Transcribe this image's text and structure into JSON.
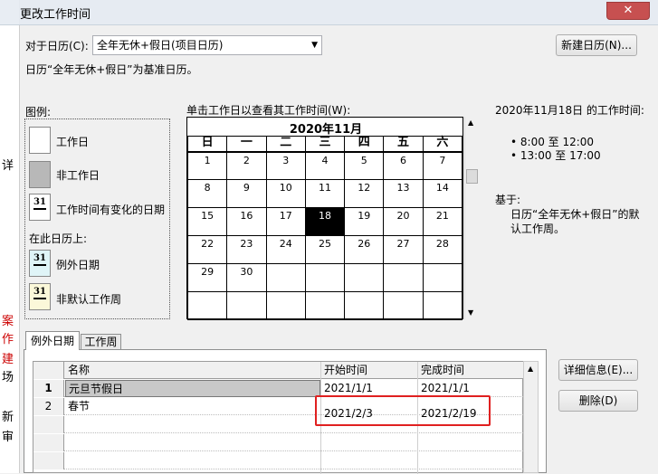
{
  "window": {
    "title": "更改工作时间",
    "close_glyph": "✕"
  },
  "background": {
    "left_chars": [
      "详",
      "案",
      "作",
      "建",
      "场",
      "新",
      "审"
    ]
  },
  "calendar_for": {
    "label": "对于日历(C):",
    "value": "全年无休+假日(项目日历)",
    "base_note": "日历“全年无休+假日”为基准日历。",
    "new_button": "新建日历(N)..."
  },
  "legend": {
    "title": "图例:",
    "items": [
      {
        "label": "工作日",
        "swatch": ""
      },
      {
        "label": "非工作日",
        "swatch": ""
      },
      {
        "label": "工作时间有变化的日期",
        "swatch": "31"
      }
    ],
    "on_this_calendar": "在此日历上:",
    "items2": [
      {
        "label": "例外日期",
        "swatch": "31"
      },
      {
        "label": "非默认工作周",
        "swatch": "31"
      }
    ]
  },
  "calendar": {
    "instruction": "单击工作日以查看其工作时间(W):",
    "month_title": "2020年11月",
    "weekdays": [
      "日",
      "一",
      "二",
      "三",
      "四",
      "五",
      "六"
    ],
    "weeks": [
      [
        "1",
        "2",
        "3",
        "4",
        "5",
        "6",
        "7"
      ],
      [
        "8",
        "9",
        "10",
        "11",
        "12",
        "13",
        "14"
      ],
      [
        "15",
        "16",
        "17",
        "18",
        "19",
        "20",
        "21"
      ],
      [
        "22",
        "23",
        "24",
        "25",
        "26",
        "27",
        "28"
      ],
      [
        "29",
        "30",
        "",
        "",
        "",
        "",
        ""
      ],
      [
        "",
        "",
        "",
        "",
        "",
        "",
        ""
      ]
    ],
    "selected": "18"
  },
  "work_time": {
    "header": "2020年11月18日 的工作时间:",
    "slots": [
      "• 8:00 至 12:00",
      "• 13:00 至 17:00"
    ],
    "based_on_label": "基于:",
    "based_on_text": "日历“全年无休+假日”的默认工作周。"
  },
  "tabs": [
    {
      "label": "例外日期"
    },
    {
      "label": "工作周"
    }
  ],
  "exceptions": {
    "columns": [
      "名称",
      "开始时间",
      "完成时间"
    ],
    "rows": [
      {
        "n": "1",
        "name": "元旦节假日",
        "start": "2021/1/1",
        "end": "2021/1/1"
      },
      {
        "n": "2",
        "name": "春节",
        "start": "2021/2/3",
        "end": "2021/2/19"
      }
    ]
  },
  "side_buttons": {
    "details": "详细信息(E)...",
    "delete": "删除(D)"
  },
  "colors": {
    "highlight": "#e02020",
    "selected_day": "#000000",
    "nonwork_swatch": "#b8b8b8",
    "exception_swatch": "#dff4f7",
    "nondefault_swatch": "#fbf8d9"
  }
}
